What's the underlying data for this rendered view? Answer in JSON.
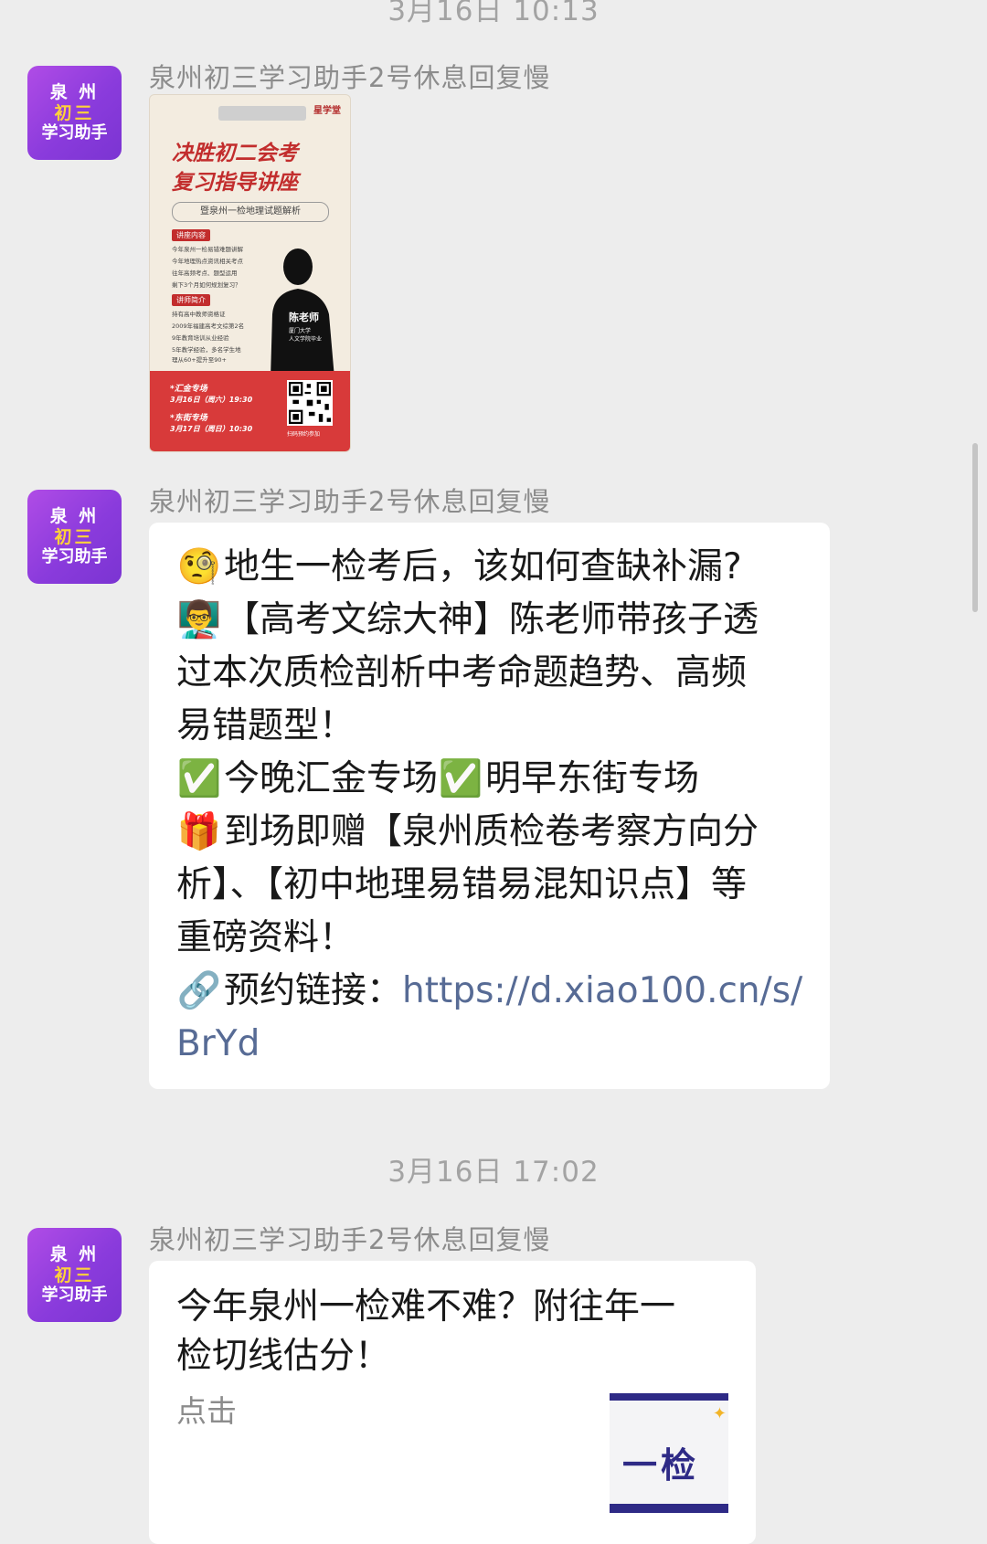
{
  "timestamps": [
    "3月16日 10:13",
    "3月16日 17:02"
  ],
  "avatar": {
    "line1": "泉 州",
    "line2": "初三",
    "line3": "学习助手"
  },
  "messages": [
    {
      "sender": "泉州初三学习助手2号休息回复慢",
      "type": "image",
      "poster": {
        "brand": "星学堂",
        "title_line1": "决胜初二会考",
        "title_line2": "复习指导讲座",
        "subtitle": "暨泉州一检地理试题解析",
        "section1_label": "讲座内容",
        "section1_items": [
          "今年泉州一检易错难题讲解",
          "今年地理热点资讯相关考点",
          "往年高频考点、题型运用",
          "剩下3个月如何规划复习？"
        ],
        "section2_label": "讲师简介",
        "section2_items": [
          "持有高中教师资格证",
          "2009年福建高考文综第2名",
          "9年教育培训从业经验",
          "5年教学经验，多名学生地",
          "理从60+提升至90+"
        ],
        "teacher_name": "陈老师",
        "teacher_school_1": "厦门大学",
        "teacher_school_2": "人文学院毕业",
        "venue1_name": "*汇金专场",
        "venue1_time": "3月16日（周六）19:30",
        "venue2_name": "*东街专场",
        "venue2_time": "3月17日（周日）10:30",
        "qr_caption": "扫码预约参加"
      }
    },
    {
      "sender": "泉州初三学习助手2号休息回复慢",
      "type": "text",
      "lines": [
        {
          "emoji": "🧐",
          "text": "地生一检考后，该如何查缺补漏?"
        },
        {
          "emoji": "👨‍🏫",
          "text": "【高考文综大神】陈老师带孩子透"
        },
        {
          "emoji": "",
          "text": "过本次质检剖析中考命题趋势、高频"
        },
        {
          "emoji": "",
          "text": "易错题型！"
        },
        {
          "emoji": "✅",
          "text": "今晚汇金专场",
          "emoji2": "✅",
          "text2": "明早东街专场"
        },
        {
          "emoji": "🎁",
          "text": "到场即赠【泉州质检卷考察方向分"
        },
        {
          "emoji": "",
          "text": "析】、【初中地理易错易混知识点】等"
        },
        {
          "emoji": "",
          "text": "重磅资料！"
        },
        {
          "emoji": "🔗",
          "text": "预约链接：",
          "link": "https://d.xiao100.cn/s/"
        },
        {
          "emoji": "",
          "text": "",
          "link": "BrYd"
        }
      ]
    },
    {
      "sender": "泉州初三学习助手2号休息回复慢",
      "type": "link-card",
      "title_line1": "今年泉州一检难不难？附往年一",
      "title_line2": "检切线估分！",
      "desc": "点击",
      "thumb_text": "一检",
      "thumb_icon": "sparkle-icon"
    }
  ]
}
